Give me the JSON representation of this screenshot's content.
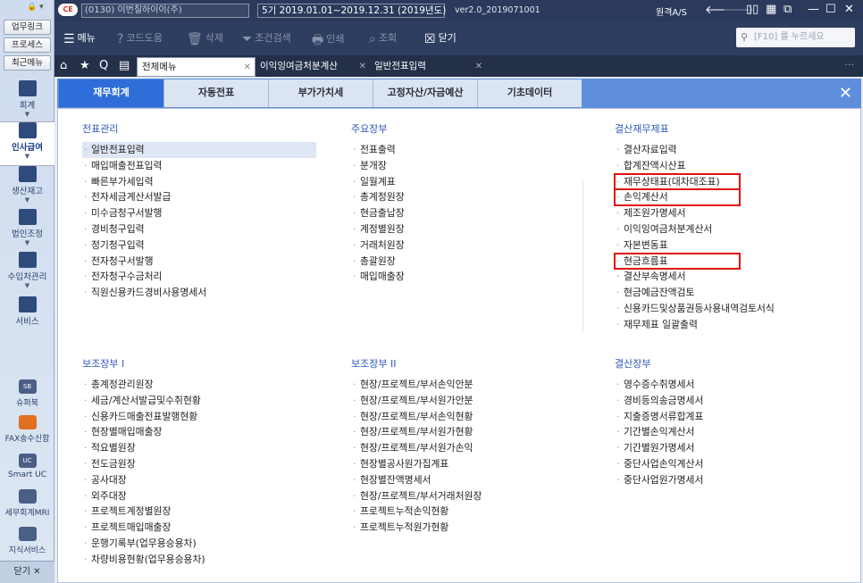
{
  "left": {
    "quick": [
      "업무링크",
      "프로세스",
      "최근메뉴"
    ],
    "nav": [
      {
        "label": "회계"
      },
      {
        "label": "인사급여"
      },
      {
        "label": "생산재고"
      },
      {
        "label": "법인조정"
      },
      {
        "label": "수입처관리"
      },
      {
        "label": "서비스"
      }
    ],
    "nav2": [
      {
        "label": "슈퍼북",
        "icon": "SB"
      },
      {
        "label": "FAX송수신함",
        "icon": ""
      },
      {
        "label": "Smart UC",
        "icon": "UC"
      },
      {
        "label": "세무회계MRI",
        "icon": ""
      },
      {
        "label": "지식서비스",
        "icon": ""
      }
    ],
    "close": "닫기 ✕"
  },
  "title": {
    "company": "(0130) 이번칠하이이(주)",
    "period": "5기 2019.01.01~2019.12.31 (2019년도)",
    "version": "ver2.0_2019071001",
    "remote": "원격A/S"
  },
  "toolbar": {
    "menu": "메뉴",
    "code": "코드도움",
    "delete": "삭제",
    "cond": "조건검색",
    "print": "인쇄",
    "view": "조회",
    "close": "닫기",
    "search_placeholder": "[F10] 를 누르세요"
  },
  "tabs": [
    {
      "label": "전체메뉴"
    },
    {
      "label": "이익잉여금처분계산"
    },
    {
      "label": "일반전표입력"
    }
  ],
  "menu_tabs": [
    "재무회계",
    "자동전표",
    "부가가치세",
    "고정자산/자금예산",
    "기초데이터"
  ],
  "sections": {
    "s1": {
      "title": "전표관리",
      "items": [
        "일반전표입력",
        "매입매출전표입력",
        "빠른부가세입력",
        "전자세금계산서발급",
        "미수금청구서발행",
        "경비청구입력",
        "정기청구입력",
        "전자청구서발행",
        "전자청구수금처리",
        "직원신용카드경비사용명세서"
      ]
    },
    "s2": {
      "title": "주요장부",
      "items": [
        "전표출력",
        "분개장",
        "일월계표",
        "총계정원장",
        "현금출납장",
        "계정별원장",
        "거래처원장",
        "총괄원장",
        "매입매출장"
      ]
    },
    "s3": {
      "title": "결산재무제표",
      "items": [
        "결산자료입력",
        "합계잔액시산표",
        "재무상태표(대차대조표)",
        "손익계산서",
        "제조원가명세서",
        "이익잉여금처분계산서",
        "자본변동표",
        "현금흐름표",
        "결산부속명세서",
        "현금예금잔액검토",
        "신용카드및상품권등사용내역검토서식",
        "재무제표 일괄출력"
      ]
    },
    "s4": {
      "title": "보조장부 I",
      "items": [
        "총계정관리원장",
        "세금/계산서발급및수취현황",
        "신용카드매출전표발행현황",
        "현장별매입매출장",
        "적요별원장",
        "전도금원장",
        "공사대장",
        "외주대장",
        "프로젝트계정별원장",
        "프로젝트매입매출장",
        "운행기록부(업무용승용차)",
        "차량비용현황(업무용승용차)"
      ]
    },
    "s5": {
      "title": "보조장부 II",
      "items": [
        "현장/프로젝트/부서손익안분",
        "현장/프로젝트/부서원가안분",
        "현장/프로젝트/부서손익현황",
        "현장/프로젝트/부서원가현황",
        "현장/프로젝트/부서원가손익",
        "현장별공사원가집계표",
        "현장별잔액명세서",
        "현장/프로젝트/부서거래처원장",
        "프로젝트누적손익현황",
        "프로젝트누적원가현황"
      ]
    },
    "s6": {
      "title": "결산장부",
      "items": [
        "영수증수취명세서",
        "경비등의송금명세서",
        "지출증명서류합계표",
        "기간별손익계산서",
        "기간별원가명세서",
        "중단사업손익계산서",
        "중단사업원가명세서"
      ]
    }
  }
}
